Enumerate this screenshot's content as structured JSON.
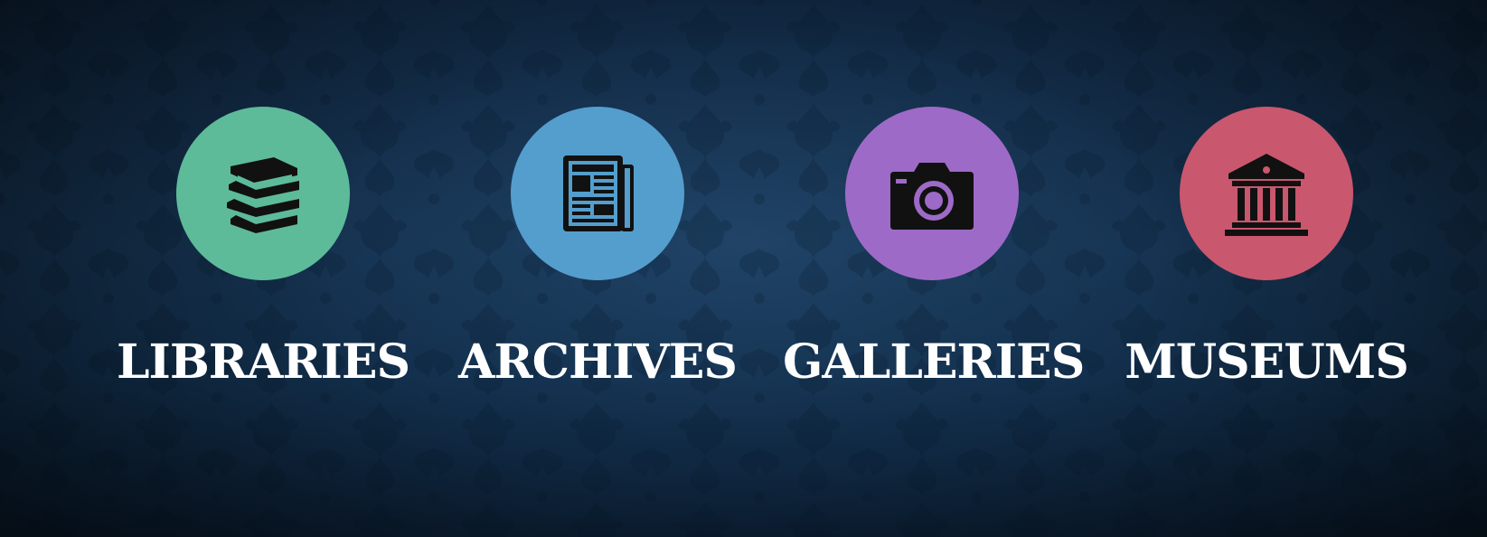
{
  "items": [
    {
      "label": "LIBRARIES",
      "icon": "books-icon",
      "color": "#5dbb9a"
    },
    {
      "label": "ARCHIVES",
      "icon": "newspaper-icon",
      "color": "#549ece"
    },
    {
      "label": "GALLERIES",
      "icon": "camera-icon",
      "color": "#9e6ac7"
    },
    {
      "label": "MUSEUMS",
      "icon": "museum-icon",
      "color": "#c9576e"
    }
  ],
  "background_color": "#163452"
}
